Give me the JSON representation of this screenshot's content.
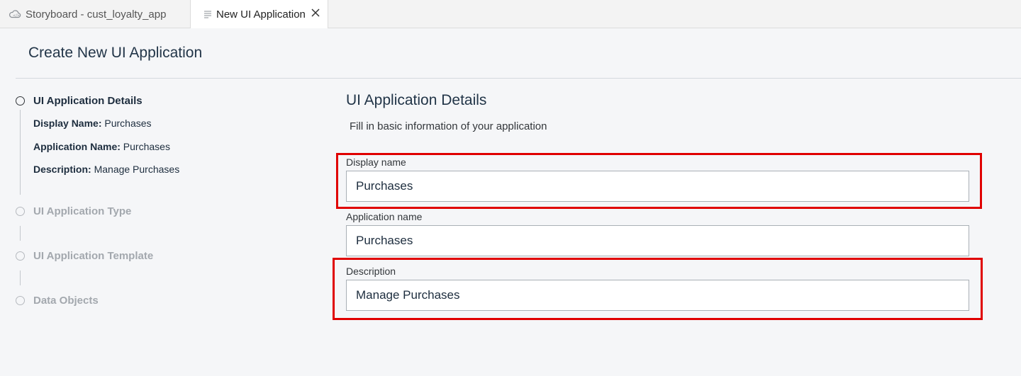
{
  "tabs": [
    {
      "label": "Storyboard - cust_loyalty_app",
      "icon": "cloud-icon"
    },
    {
      "label": "New UI Application",
      "icon": "document-lines-icon"
    }
  ],
  "page": {
    "title": "Create New UI Application"
  },
  "steps": [
    {
      "label": "UI Application Details",
      "active": true
    },
    {
      "label": "UI Application Type",
      "active": false
    },
    {
      "label": "UI Application Template",
      "active": false
    },
    {
      "label": "Data Objects",
      "active": false
    }
  ],
  "summary": {
    "display_name_key": "Display Name:",
    "display_name_val": "Purchases",
    "app_name_key": "Application Name:",
    "app_name_val": "Purchases",
    "desc_key": "Description:",
    "desc_val": "Manage Purchases"
  },
  "form": {
    "title": "UI Application Details",
    "subtitle": "Fill in basic information of your application",
    "display_name_label": "Display name",
    "display_name_value": "Purchases",
    "app_name_label": "Application name",
    "app_name_value": "Purchases",
    "description_label": "Description",
    "description_value": "Manage Purchases"
  },
  "colors": {
    "highlight": "#e00000",
    "text": "#1d2d3e",
    "muted": "#a3a8ae"
  }
}
